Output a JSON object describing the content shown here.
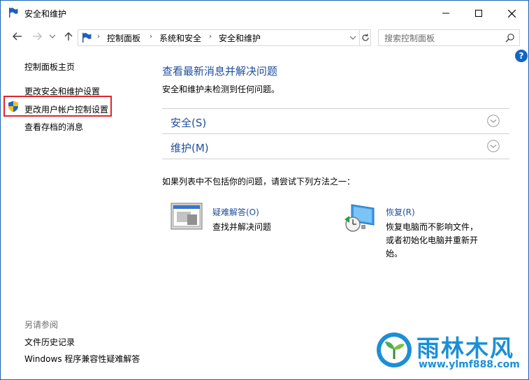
{
  "window": {
    "title": "安全和维护"
  },
  "nav": {
    "breadcrumbs": [
      "控制面板",
      "系统和安全",
      "安全和维护"
    ],
    "search_placeholder": "搜索控制面板"
  },
  "sidebar": {
    "home": "控制面板主页",
    "links": [
      "更改安全和维护设置",
      "更改用户帐户控制设置",
      "查看存档的消息"
    ],
    "see_also_label": "另请参阅",
    "see_also": [
      "文件历史记录",
      "Windows 程序兼容性疑难解答"
    ]
  },
  "main": {
    "title": "查看最新消息并解决问题",
    "subtitle": "安全和维护未检测到任何问题。",
    "sections": [
      "安全(S)",
      "维护(M)"
    ],
    "hint": "如果列表中不包括你的问题，请尝试下列方法之一：",
    "tools": [
      {
        "label": "疑难解答(O)",
        "desc": [
          "查找并解决问题"
        ]
      },
      {
        "label": "恢复(R)",
        "desc": [
          "恢复电脑而不影响文件，",
          "或者初始化电脑并重新开",
          "始。"
        ]
      }
    ]
  },
  "watermark": {
    "title": "雨林木风",
    "url": "www.ylmf888.com"
  },
  "colors": {
    "link": "#1e4e9c",
    "highlight": "#e0262c",
    "watermark": "#1b8fd6"
  }
}
